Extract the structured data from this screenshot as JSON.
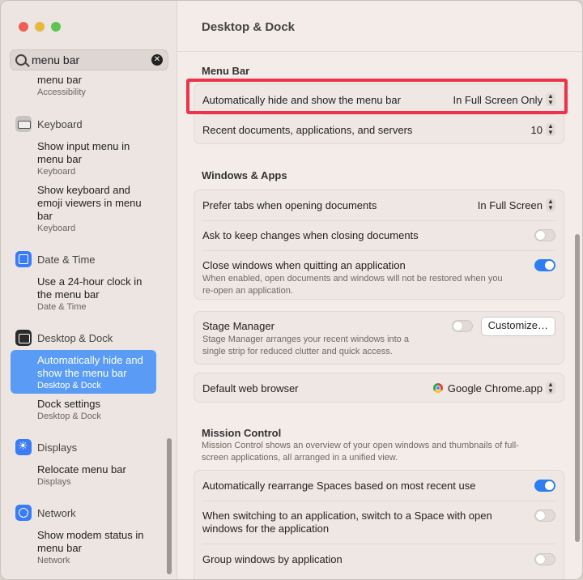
{
  "window": {
    "title": "Desktop & Dock"
  },
  "search": {
    "value": "menu bar"
  },
  "sidebar": {
    "top_item": {
      "title": "menu bar",
      "subtitle": "Accessibility"
    },
    "keyboard": {
      "label": "Keyboard",
      "items": [
        {
          "title_a": "Show input menu in",
          "title_b": "menu bar",
          "subtitle": "Keyboard"
        },
        {
          "title_a": "Show keyboard and",
          "title_b": "emoji viewers in menu",
          "title_c": "bar",
          "subtitle": "Keyboard"
        }
      ]
    },
    "datetime": {
      "label": "Date & Time",
      "item": {
        "title_a": "Use a 24-hour clock in",
        "title_b": "the menu bar",
        "subtitle": "Date & Time"
      }
    },
    "desktop": {
      "label": "Desktop & Dock",
      "items": [
        {
          "title_a": "Automatically hide and",
          "title_b": "show the menu bar",
          "subtitle": "Desktop & Dock"
        },
        {
          "title_a": "Dock settings",
          "subtitle": "Desktop & Dock"
        }
      ]
    },
    "displays": {
      "label": "Displays",
      "item": {
        "title_a": "Relocate menu bar",
        "subtitle": "Displays"
      }
    },
    "network": {
      "label": "Network",
      "item": {
        "title_a": "Show modem status in",
        "title_b": "menu bar",
        "subtitle": "Network"
      }
    }
  },
  "menu_bar": {
    "title": "Menu Bar",
    "auto_hide": {
      "label": "Automatically hide and show the menu bar",
      "value": "In Full Screen Only"
    },
    "recent": {
      "label": "Recent documents, applications, and servers",
      "value": "10"
    }
  },
  "windows_apps": {
    "title": "Windows & Apps",
    "prefer_tabs": {
      "label": "Prefer tabs when opening documents",
      "value": "In Full Screen"
    },
    "ask_keep": {
      "label": "Ask to keep changes when closing documents",
      "on": false
    },
    "close_windows": {
      "label": "Close windows when quitting an application",
      "desc_a": "When enabled, open documents and windows will not be restored when you",
      "desc_b": "re-open an application.",
      "on": true
    },
    "stage_manager": {
      "label": "Stage Manager",
      "desc_a": "Stage Manager arranges your recent windows into a",
      "desc_b": "single strip for reduced clutter and quick access.",
      "on": false,
      "button": "Customize…"
    },
    "browser": {
      "label": "Default web browser",
      "value": "Google Chrome.app"
    }
  },
  "mission_control": {
    "title": "Mission Control",
    "desc_a": "Mission Control shows an overview of your open windows and thumbnails of full-",
    "desc_b": "screen applications, all arranged in a unified view.",
    "rearrange": {
      "label": "Automatically rearrange Spaces based on most recent use",
      "on": true
    },
    "switch_space": {
      "label_a": "When switching to an application, switch to a Space with open",
      "label_b": "windows for the application",
      "on": false
    },
    "group": {
      "label": "Group windows by application",
      "on": false
    }
  },
  "colors": {
    "accent": "#2c7ef2",
    "highlight": "#ee3349",
    "selection": "#5a9cf5"
  }
}
